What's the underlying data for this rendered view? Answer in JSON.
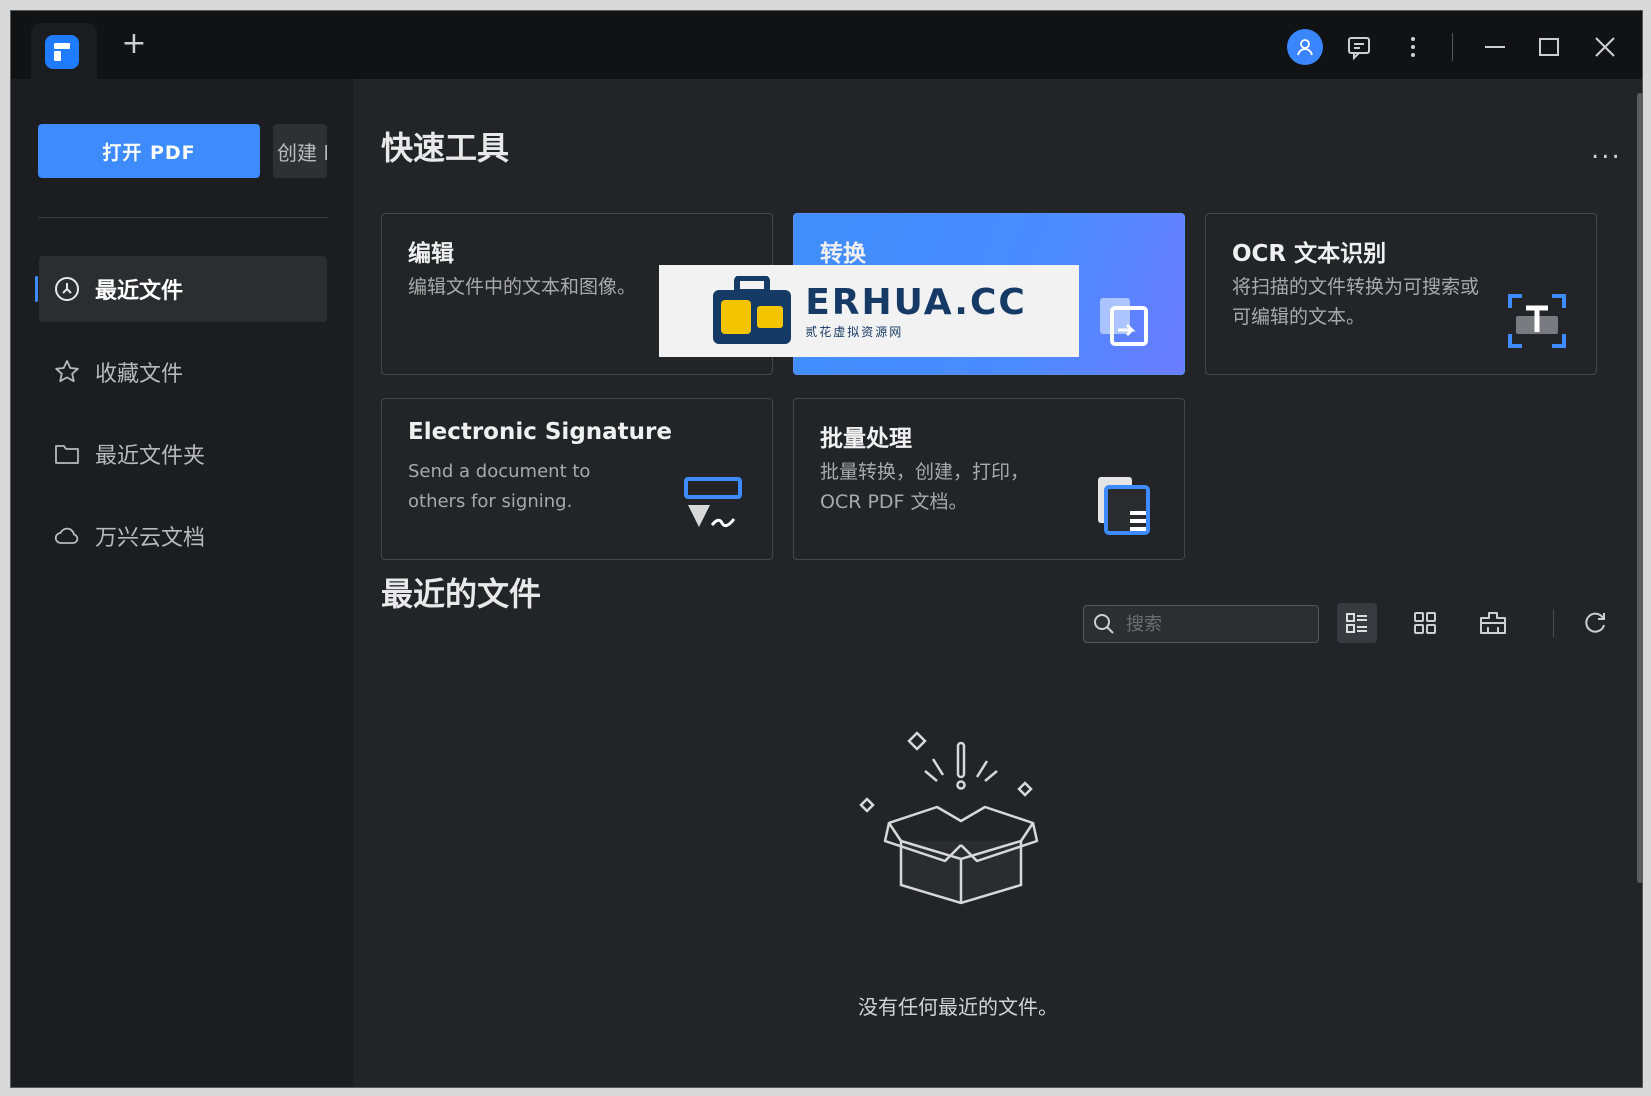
{
  "titlebar": {
    "new_tab": "+",
    "icons": [
      "app-logo-icon",
      "plus-icon",
      "user-avatar-icon",
      "feedback-icon",
      "more-vertical-icon",
      "minimize-icon",
      "maximize-icon",
      "close-icon"
    ]
  },
  "sidebar": {
    "open_pdf": "打开 PDF",
    "create": "创建 PDF",
    "items": [
      {
        "label": "最近文件",
        "icon": "clock-icon",
        "active": true
      },
      {
        "label": "收藏文件",
        "icon": "star-icon",
        "active": false
      },
      {
        "label": "最近文件夹",
        "icon": "folder-icon",
        "active": false
      },
      {
        "label": "万兴云文档",
        "icon": "cloud-icon",
        "active": false
      }
    ]
  },
  "quick_tools": {
    "title": "快速工具",
    "more": "...",
    "cards": [
      {
        "title": "编辑",
        "desc": "编辑文件中的文本和图像。",
        "icon": "edit-icon"
      },
      {
        "title": "转换",
        "desc": "",
        "icon": "convert-icon"
      },
      {
        "title": "OCR 文本识别",
        "desc": "将扫描的文件转换为可搜索或可编辑的文本。",
        "icon": "ocr-icon"
      },
      {
        "title": "Electronic Signature",
        "desc": "Send a document to others for signing.",
        "icon": "signature-icon"
      },
      {
        "title": "批量处理",
        "desc": "批量转换，创建，打印，OCR PDF 文档。",
        "icon": "batch-icon"
      }
    ]
  },
  "watermark": {
    "brand": "ERHUA.CC",
    "sub": "贰花虚拟资源网"
  },
  "recent": {
    "title": "最近的文件",
    "search_placeholder": "搜索",
    "empty_text": "没有任何最近的文件。"
  },
  "colors": {
    "accent": "#3d8bfd",
    "background": "#232427",
    "sidebar": "#1c1d20",
    "titlebar": "#111214"
  }
}
